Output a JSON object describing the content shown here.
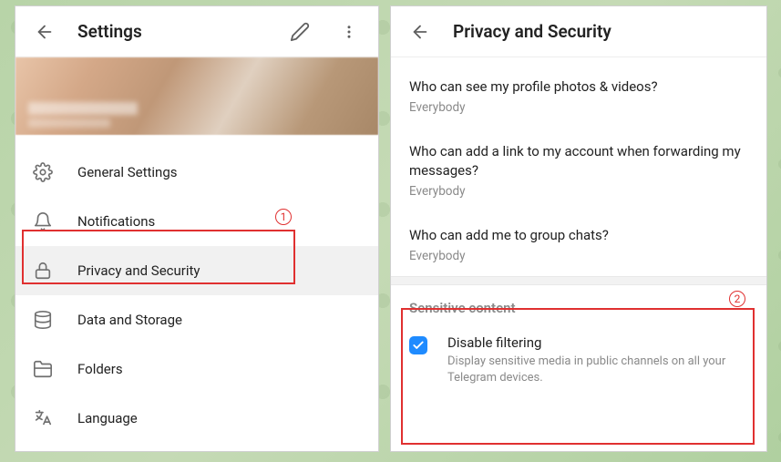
{
  "settings": {
    "title": "Settings",
    "menu": [
      {
        "label": "General Settings"
      },
      {
        "label": "Notifications"
      },
      {
        "label": "Privacy and Security"
      },
      {
        "label": "Data and Storage"
      },
      {
        "label": "Folders"
      },
      {
        "label": "Language"
      }
    ]
  },
  "privacy": {
    "title": "Privacy and Security",
    "rows": [
      {
        "question": "Who can see my profile photos & videos?",
        "value": "Everybody"
      },
      {
        "question": "Who can add a link to my account when forwarding my messages?",
        "value": "Everybody"
      },
      {
        "question": "Who can add me to group chats?",
        "value": "Everybody"
      }
    ],
    "sensitive_section_title": "Sensitive content",
    "disable_filtering": {
      "label": "Disable filtering",
      "description": "Display sensitive media in public channels on all your Telegram devices.",
      "checked": true
    }
  },
  "callouts": {
    "one": "1",
    "two": "2"
  }
}
